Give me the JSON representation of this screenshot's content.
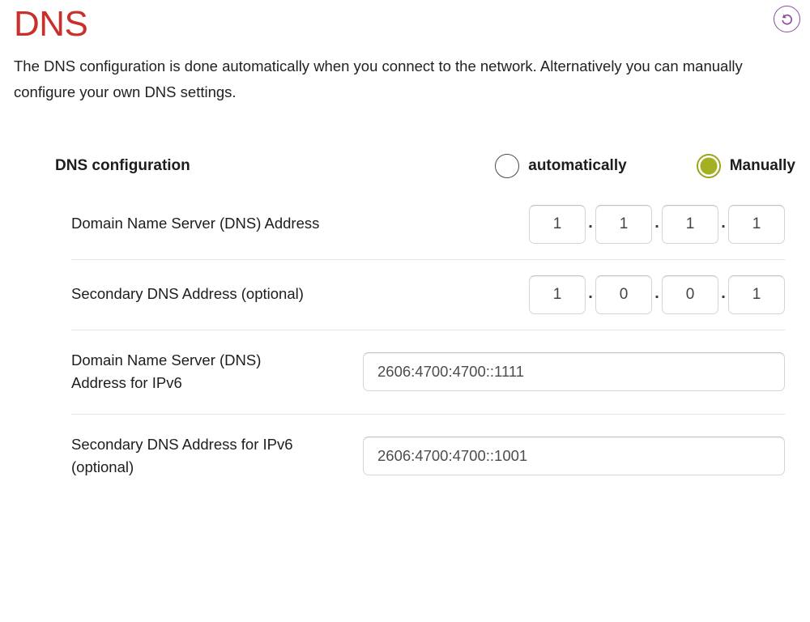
{
  "header": {
    "title": "DNS",
    "title_color": "#c9302c",
    "reset_icon": "reset-circular-arrow-icon",
    "reset_icon_color": "#8e4a9e"
  },
  "description": "The DNS configuration is done automatically when you connect to the network. Alternatively you can manually configure your own DNS settings.",
  "config": {
    "label": "DNS configuration",
    "options": [
      {
        "label": "automatically",
        "selected": false
      },
      {
        "label": "Manually",
        "selected": true
      }
    ],
    "selected_color": "#a5af22"
  },
  "fields": {
    "dns_v4": {
      "label": "Domain Name Server (DNS) Address",
      "octets": [
        "1",
        "1",
        "1",
        "1"
      ],
      "separator": "."
    },
    "dns_v4_secondary": {
      "label": "Secondary DNS Address (optional)",
      "octets": [
        "1",
        "0",
        "0",
        "1"
      ],
      "separator": "."
    },
    "dns_v6": {
      "label_line1": "Domain Name Server (DNS)",
      "label_line2": "Address for IPv6",
      "value": "2606:4700:4700::1111"
    },
    "dns_v6_secondary": {
      "label_line1": "Secondary DNS Address for IPv6",
      "label_line2": "(optional)",
      "value": "2606:4700:4700::1001"
    }
  }
}
